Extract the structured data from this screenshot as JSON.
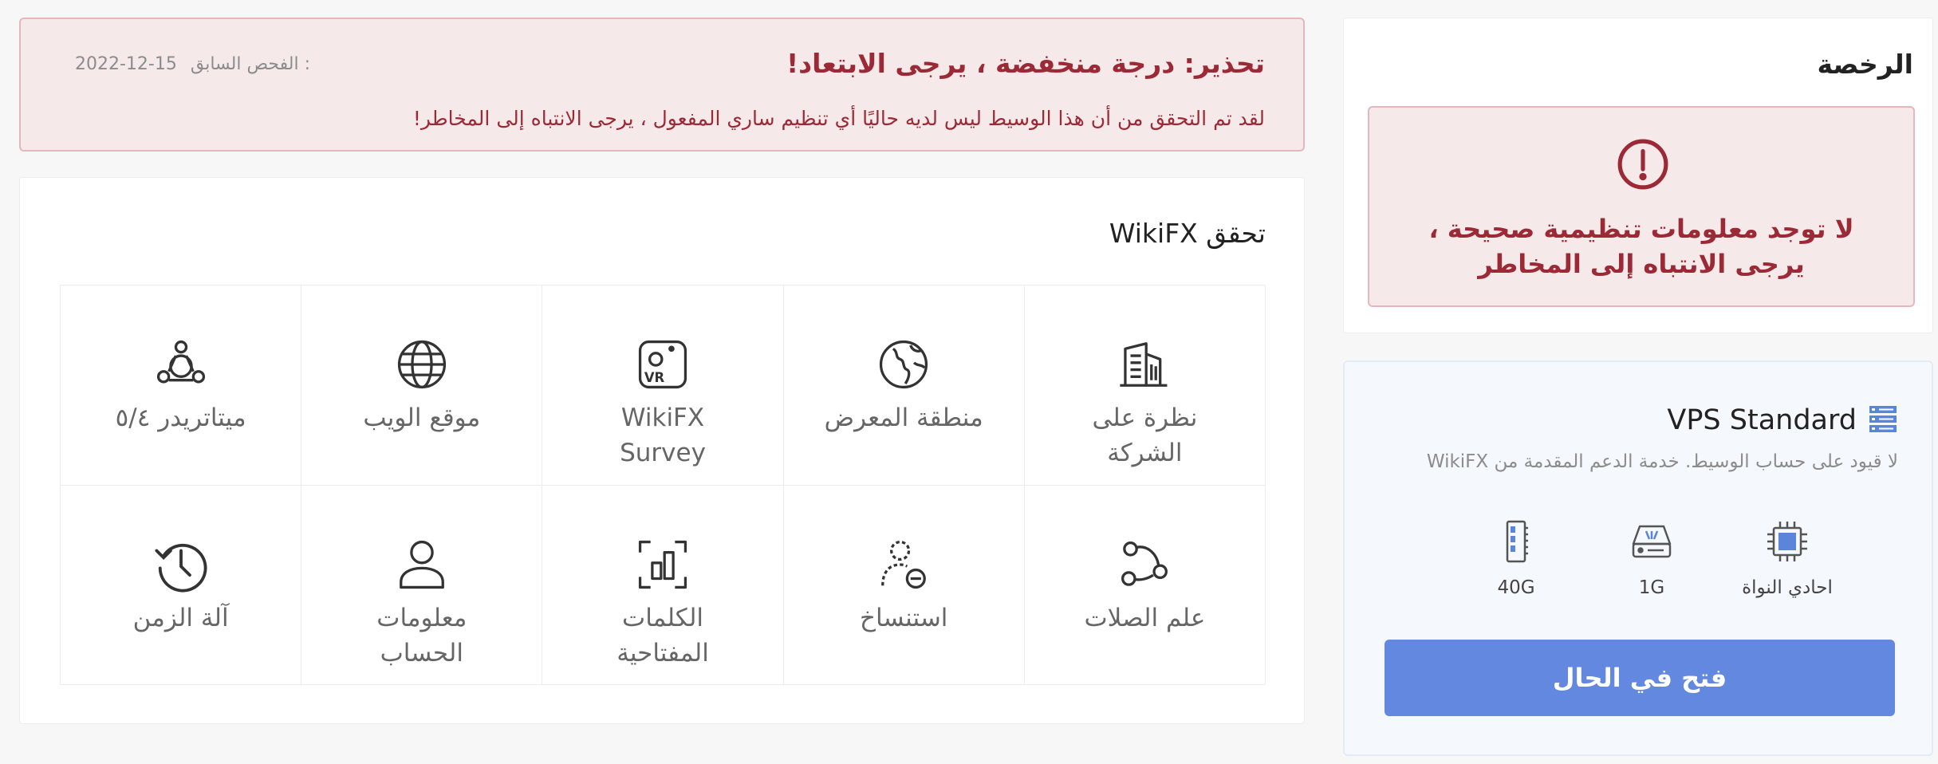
{
  "warning": {
    "title": "تحذير: درجة منخفضة ، يرجى الابتعاد!",
    "message": "لقد تم التحقق من أن هذا الوسيط ليس لديه حاليًا أي تنظيم ساري المفعول ، يرجى الانتباه إلى المخاطر!",
    "last_check_label": "الفحص السابق :",
    "last_check_date": "2022-12-15"
  },
  "verify": {
    "title": "تحقق WikiFX",
    "items": [
      {
        "label": "نظرة على الشركة",
        "icon": "building-icon"
      },
      {
        "label": "منطقة المعرض",
        "icon": "globe-map-icon"
      },
      {
        "label": "WikiFX Survey",
        "icon": "vr-survey-icon"
      },
      {
        "label": "موقع الويب",
        "icon": "globe-icon"
      },
      {
        "label": "ميتاتريدر ٥/٤",
        "icon": "metatrader-icon"
      },
      {
        "label": "علم الصلات",
        "icon": "relations-icon"
      },
      {
        "label": "استنساخ",
        "icon": "clone-person-icon"
      },
      {
        "label": "الكلمات المفتاحية",
        "icon": "keywords-icon"
      },
      {
        "label": "معلومات الحساب",
        "icon": "user-icon"
      },
      {
        "label": "آلة الزمن",
        "icon": "history-icon"
      }
    ]
  },
  "license": {
    "title": "الرخصة",
    "message": "لا توجد معلومات تنظيمية صحيحة ، يرجى الانتباه إلى المخاطر",
    "icon": "alert-circle-icon"
  },
  "vps": {
    "title": "VPS Standard",
    "icon": "server-icon",
    "description": "لا قيود على حساب الوسيط. خدمة الدعم المقدمة من WikiFX",
    "specs": [
      {
        "label": "احادي النواة",
        "icon": "cpu-icon"
      },
      {
        "label": "1G",
        "icon": "disk-icon"
      },
      {
        "label": "40G",
        "icon": "memory-icon"
      }
    ],
    "button_label": "فتح في الحال"
  },
  "colors": {
    "warning_text": "#9c2a36",
    "warning_bg": "#f5e9ea",
    "button": "#6288df"
  }
}
